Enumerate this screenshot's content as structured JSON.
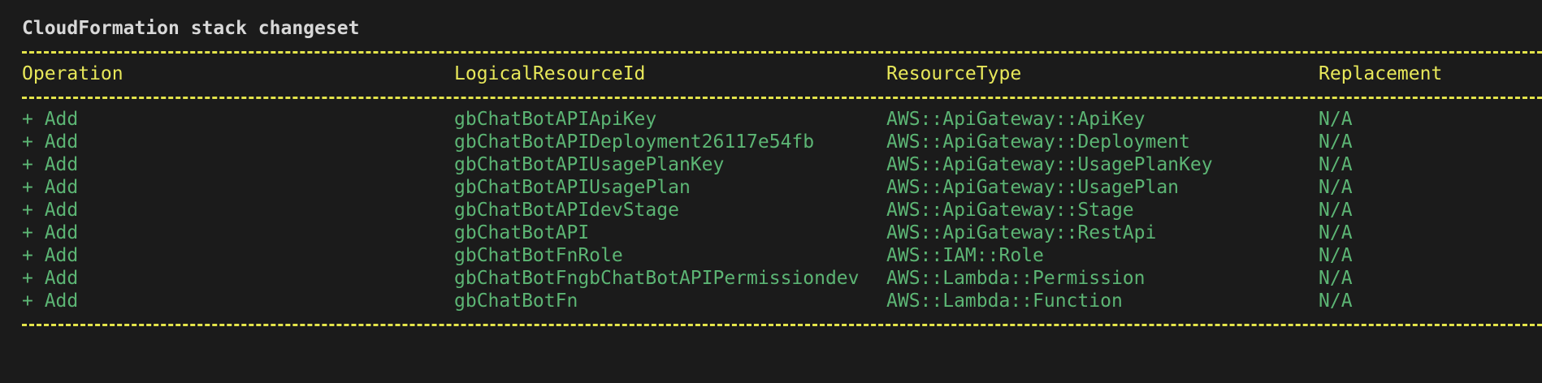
{
  "title": "CloudFormation stack changeset",
  "colors": {
    "background": "#1b1b1b",
    "title": "#d8d8d8",
    "header": "#e8e85a",
    "rule": "#e3e34a",
    "row": "#5cb574"
  },
  "headers": [
    "Operation",
    "LogicalResourceId",
    "ResourceType",
    "Replacement"
  ],
  "rows": [
    {
      "operation": "+ Add",
      "logical_id": "gbChatBotAPIApiKey",
      "resource_type": "AWS::ApiGateway::ApiKey",
      "replacement": "N/A"
    },
    {
      "operation": "+ Add",
      "logical_id": "gbChatBotAPIDeployment26117e54fb",
      "resource_type": "AWS::ApiGateway::Deployment",
      "replacement": "N/A"
    },
    {
      "operation": "+ Add",
      "logical_id": "gbChatBotAPIUsagePlanKey",
      "resource_type": "AWS::ApiGateway::UsagePlanKey",
      "replacement": "N/A"
    },
    {
      "operation": "+ Add",
      "logical_id": "gbChatBotAPIUsagePlan",
      "resource_type": "AWS::ApiGateway::UsagePlan",
      "replacement": "N/A"
    },
    {
      "operation": "+ Add",
      "logical_id": "gbChatBotAPIdevStage",
      "resource_type": "AWS::ApiGateway::Stage",
      "replacement": "N/A"
    },
    {
      "operation": "+ Add",
      "logical_id": "gbChatBotAPI",
      "resource_type": "AWS::ApiGateway::RestApi",
      "replacement": "N/A"
    },
    {
      "operation": "+ Add",
      "logical_id": "gbChatBotFnRole",
      "resource_type": "AWS::IAM::Role",
      "replacement": "N/A"
    },
    {
      "operation": "+ Add",
      "logical_id": "gbChatBotFngbChatBotAPIPermissiondev",
      "resource_type": "AWS::Lambda::Permission",
      "replacement": "N/A"
    },
    {
      "operation": "+ Add",
      "logical_id": "gbChatBotFn",
      "resource_type": "AWS::Lambda::Function",
      "replacement": "N/A"
    }
  ]
}
